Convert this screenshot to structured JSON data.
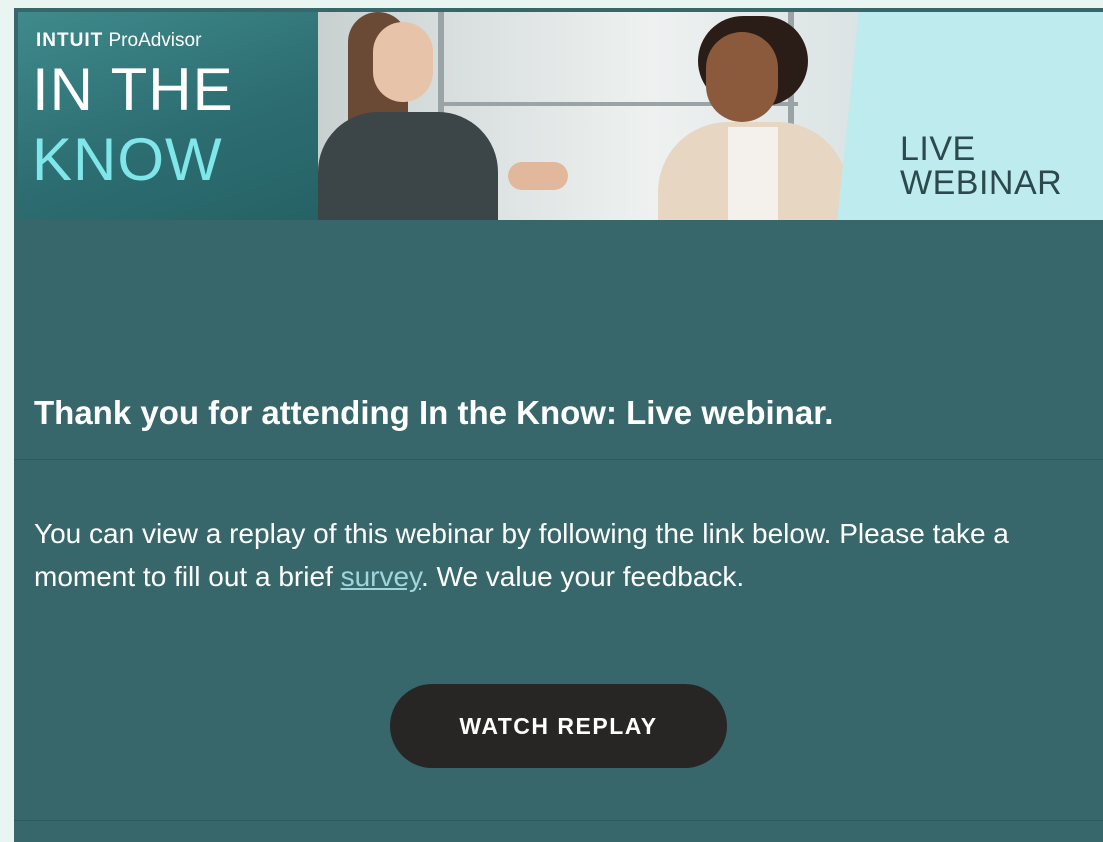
{
  "banner": {
    "brand_intuit": "INTUIT",
    "brand_proadvisor": "ProAdvisor",
    "title_line1": "IN THE",
    "title_line2": "KNOW",
    "live_line1": "LIVE",
    "live_line2": "WEBINAR"
  },
  "content": {
    "headline": "Thank you for attending In the Know: Live webinar.",
    "body_before_link": "You can view a replay of this webinar by following the link below. Please take a moment to fill out a brief ",
    "survey_link": "survey",
    "body_after_link": ". We value your feedback.",
    "button_label": "WATCH REPLAY"
  },
  "colors": {
    "background": "#37676a",
    "accent_text": "#7fe6ea",
    "button": "#272625",
    "link": "#9fd5dc"
  }
}
